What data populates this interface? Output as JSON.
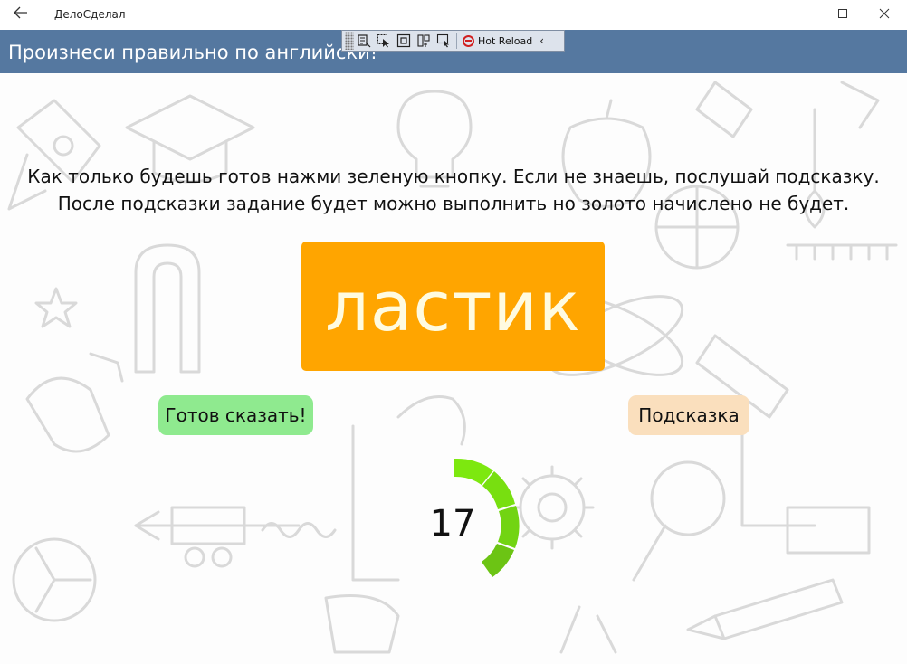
{
  "window": {
    "title": "ДелоСделал",
    "back_icon": "back-arrow-icon",
    "minimize_glyph": "—",
    "maximize_glyph": "☐",
    "close_glyph": "✕"
  },
  "header": {
    "title": "Произнеси правильно по английски!",
    "background": "#5578a0"
  },
  "hot_reload_toolbar": {
    "icons": [
      "live-visual-tree-icon",
      "select-element-icon",
      "display-layout-adorners-icon",
      "track-focus-icon",
      "preview-selection-icon"
    ],
    "label": "Hot Reload",
    "chevron": "‹"
  },
  "instructions": {
    "line1": "Как только будешь готов нажми зеленую кнопку. Если не знаешь, послушай подсказку.",
    "line2": "После подсказки задание будет можно выполнить но золото начислено не будет."
  },
  "word": {
    "text": "ластик",
    "background": "#ffa500"
  },
  "buttons": {
    "ready_label": "Готов сказать!",
    "ready_color": "#8fea8f",
    "hint_label": "Подсказка",
    "hint_color": "#fadfbd"
  },
  "timer": {
    "value": "17",
    "colors": [
      "#7de80f",
      "#6cc414"
    ]
  }
}
